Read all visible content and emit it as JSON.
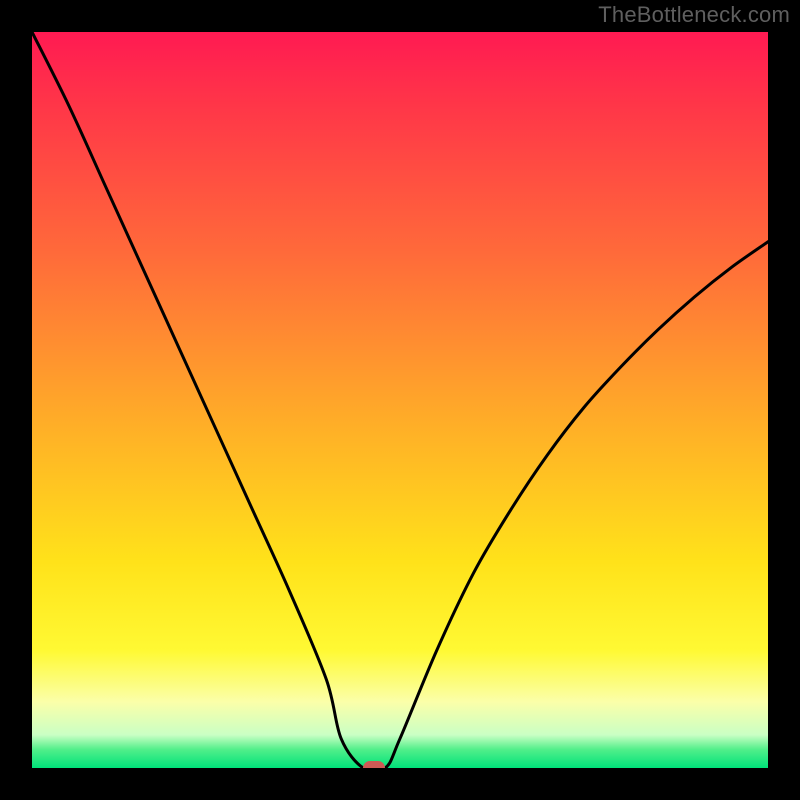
{
  "watermark": "TheBottleneck.com",
  "chart_data": {
    "type": "line",
    "title": "",
    "xlabel": "",
    "ylabel": "",
    "xlim": [
      0,
      100
    ],
    "ylim": [
      0,
      100
    ],
    "grid": false,
    "legend": false,
    "gradient_stops": [
      {
        "pct": 0,
        "color": "#ff1a52"
      },
      {
        "pct": 10,
        "color": "#ff3648"
      },
      {
        "pct": 30,
        "color": "#ff6a3a"
      },
      {
        "pct": 55,
        "color": "#ffb326"
      },
      {
        "pct": 72,
        "color": "#ffe21a"
      },
      {
        "pct": 84,
        "color": "#fff933"
      },
      {
        "pct": 91,
        "color": "#fbffa9"
      },
      {
        "pct": 95.5,
        "color": "#caffc4"
      },
      {
        "pct": 97.5,
        "color": "#51ef8a"
      },
      {
        "pct": 100,
        "color": "#00e27a"
      }
    ],
    "series": [
      {
        "name": "bottleneck-curve",
        "x": [
          0,
          5,
          10,
          15,
          20,
          25,
          30,
          35,
          40,
          42,
          45,
          48,
          50,
          55,
          60,
          65,
          70,
          75,
          80,
          85,
          90,
          95,
          100
        ],
        "values": [
          100,
          90,
          79,
          68,
          57,
          46,
          35,
          24,
          12,
          4,
          0,
          0,
          4,
          16,
          26.5,
          35,
          42.5,
          49,
          54.5,
          59.5,
          64,
          68,
          71.5
        ]
      }
    ],
    "marker": {
      "x": 46.5,
      "y": 0,
      "color": "#cd5a55"
    }
  }
}
